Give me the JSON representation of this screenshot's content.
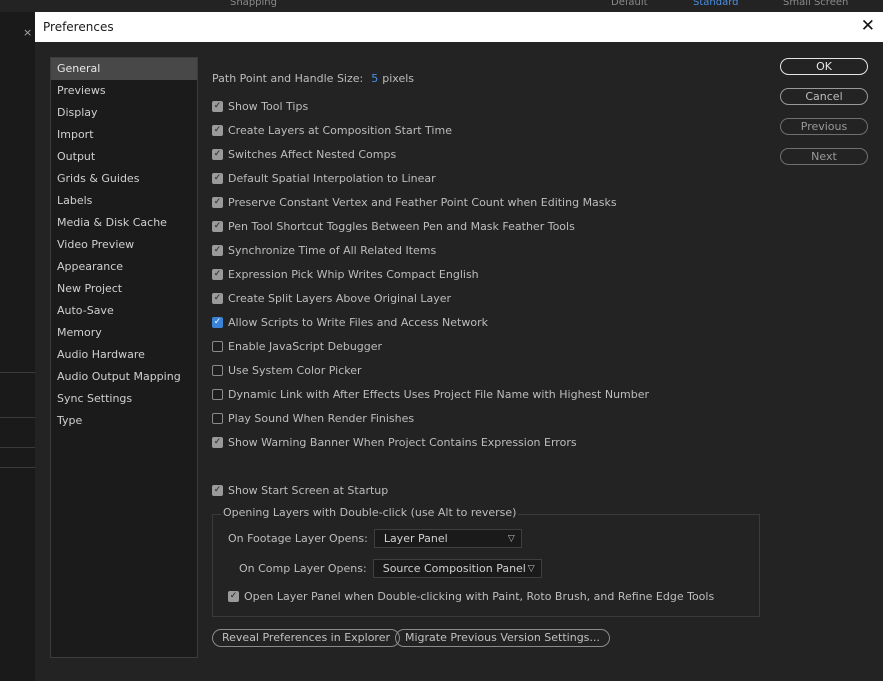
{
  "dialog": {
    "title": "Preferences"
  },
  "background": {
    "top_labels": [
      "Snapping",
      "Default",
      "Standard",
      "Small Screen"
    ]
  },
  "sidebar": {
    "items": [
      {
        "label": "General",
        "selected": true
      },
      {
        "label": "Previews"
      },
      {
        "label": "Display"
      },
      {
        "label": "Import"
      },
      {
        "label": "Output"
      },
      {
        "label": "Grids & Guides"
      },
      {
        "label": "Labels"
      },
      {
        "label": "Media & Disk Cache"
      },
      {
        "label": "Video Preview"
      },
      {
        "label": "Appearance"
      },
      {
        "label": "New Project"
      },
      {
        "label": "Auto-Save"
      },
      {
        "label": "Memory"
      },
      {
        "label": "Audio Hardware"
      },
      {
        "label": "Audio Output Mapping"
      },
      {
        "label": "Sync Settings"
      },
      {
        "label": "Type"
      }
    ]
  },
  "general": {
    "path_point": {
      "label": "Path Point and Handle Size:",
      "value": "5",
      "unit": "pixels"
    },
    "options": [
      {
        "label": "Show Tool Tips",
        "checked": true
      },
      {
        "label": "Create Layers at Composition Start Time",
        "checked": true
      },
      {
        "label": "Switches Affect Nested Comps",
        "checked": true
      },
      {
        "label": "Default Spatial Interpolation to Linear",
        "checked": true
      },
      {
        "label": "Preserve Constant Vertex and Feather Point Count when Editing Masks",
        "checked": true
      },
      {
        "label": "Pen Tool Shortcut Toggles Between Pen and Mask Feather Tools",
        "checked": true
      },
      {
        "label": "Synchronize Time of All Related Items",
        "checked": true
      },
      {
        "label": "Expression Pick Whip Writes Compact English",
        "checked": true
      },
      {
        "label": "Create Split Layers Above Original Layer",
        "checked": true
      },
      {
        "label": "Allow Scripts to Write Files and Access Network",
        "checked": true,
        "accent": true
      },
      {
        "label": "Enable JavaScript Debugger",
        "checked": false
      },
      {
        "label": "Use System Color Picker",
        "checked": false
      },
      {
        "label": "Dynamic Link with After Effects Uses Project File Name with Highest Number",
        "checked": false
      },
      {
        "label": "Play Sound When Render Finishes",
        "checked": false
      },
      {
        "label": "Show Warning Banner When Project Contains Expression Errors",
        "checked": true
      }
    ],
    "start_screen": {
      "label": "Show Start Screen at Startup",
      "checked": true
    },
    "group": {
      "title": "Opening Layers with Double-click (use Alt to reverse)",
      "footage_label": "On Footage Layer Opens:",
      "footage_value": "Layer Panel",
      "comp_label": "On Comp Layer Opens:",
      "comp_value": "Source Composition Panel",
      "paint_option": {
        "label": "Open Layer Panel when Double-clicking with Paint, Roto Brush, and Refine Edge Tools",
        "checked": true
      }
    },
    "reveal_button": "Reveal Preferences in Explorer",
    "migrate_button": "Migrate Previous Version Settings..."
  },
  "buttons": {
    "ok": "OK",
    "cancel": "Cancel",
    "previous": "Previous",
    "next": "Next"
  },
  "colors": {
    "accent": "#3a83d9",
    "value_blue": "#4a90e2",
    "dialog_bg": "#232323"
  }
}
